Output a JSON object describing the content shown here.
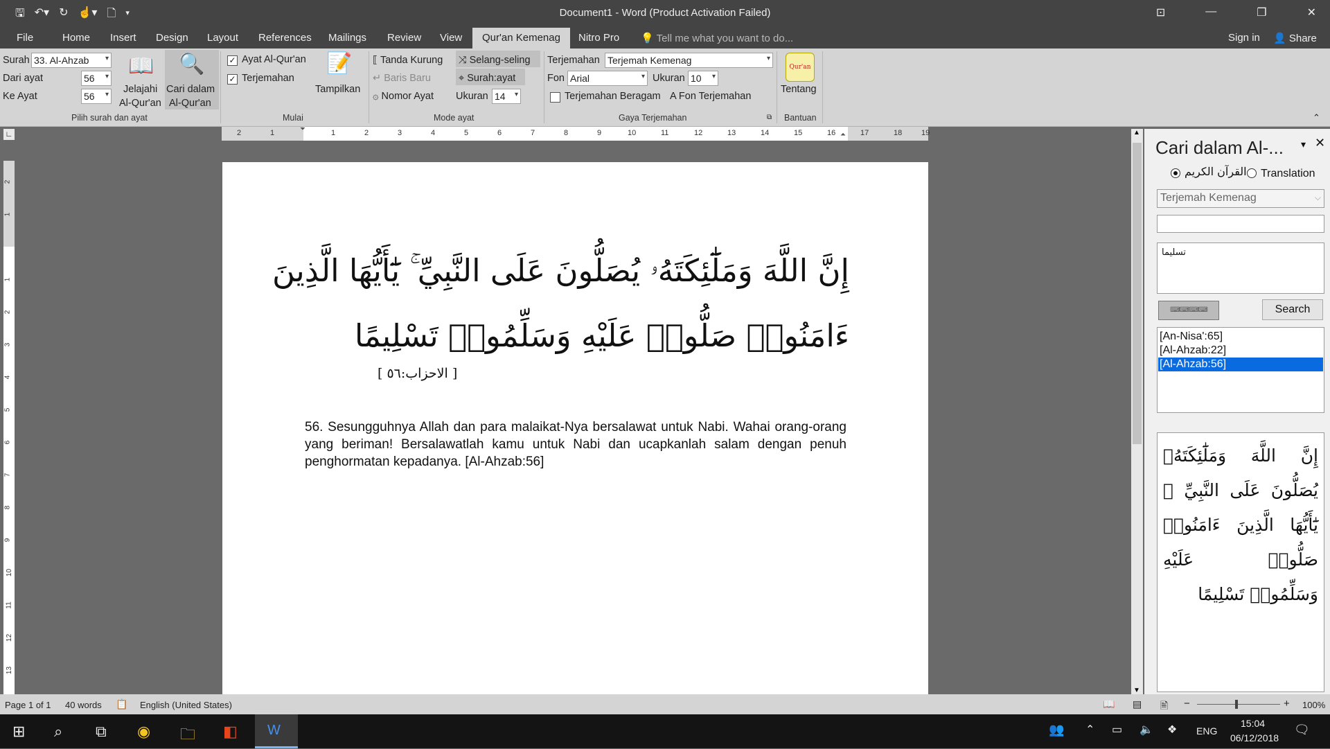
{
  "window": {
    "title": "Document1 - Word (Product Activation Failed)",
    "qat_icons": [
      "save-icon",
      "undo-icon",
      "redo-icon",
      "touch-mode-icon",
      "new-doc-icon",
      "customize-icon"
    ],
    "controls": [
      "ribbon-display-icon",
      "minimize-icon",
      "maximize-icon",
      "close-icon"
    ]
  },
  "tabs": [
    "File",
    "Home",
    "Insert",
    "Design",
    "Layout",
    "References",
    "Mailings",
    "Review",
    "View",
    "Qur'an Kemenag",
    "Nitro Pro"
  ],
  "active_tab": "Qur'an Kemenag",
  "tell_me": "Tell me what you want to do...",
  "sign_in": "Sign in",
  "share": "Share",
  "ribbon": {
    "surah_label": "Surah",
    "surah_value": "33. Al-Ahzab",
    "dari_label": "Dari ayat",
    "dari_value": "56",
    "ke_label": "Ke Ayat",
    "ke_value": "56",
    "jelajahi_1": "Jelajahi",
    "jelajahi_2": "Al-Qur'an",
    "cari_1": "Cari dalam",
    "cari_2": "Al-Qur'an",
    "group1": "Pilih surah dan ayat",
    "ayat_check": "Ayat Al-Qur'an",
    "terjemahan_check": "Terjemahan",
    "tampilkan": "Tampilkan",
    "group2": "Mulai",
    "tanda_kurung": "Tanda Kurung",
    "selang_seling": "Selang-seling",
    "baris_baru": "Baris Baru",
    "surah_ayat": "Surah:ayat",
    "nomor_ayat": "Nomor Ayat",
    "ukuran_label": "Ukuran",
    "ukuran_value": "14",
    "group3": "Mode ayat",
    "terjemahan_label": "Terjemahan",
    "terjemahan_value": "Terjemah Kemenag",
    "fon_label": "Fon",
    "fon_value": "Arial",
    "ukuran2_label": "Ukuran",
    "ukuran2_value": "10",
    "beragam": "Terjemahan Beragam",
    "fon_terjemahan": "Fon Terjemahan",
    "group4": "Gaya Terjemahan",
    "logo_text": "Qur'an",
    "tentang": "Tentang",
    "group5": "Bantuan"
  },
  "ruler_h": [
    "2",
    "1",
    "1",
    "1",
    "2",
    "3",
    "4",
    "5",
    "6",
    "7",
    "8",
    "9",
    "10",
    "11",
    "12",
    "13",
    "14",
    "15",
    "16",
    "17",
    "18",
    "19"
  ],
  "ruler_v": [
    "2",
    "1",
    "1",
    "2",
    "3",
    "4",
    "5",
    "6",
    "7",
    "8",
    "9",
    "10",
    "11",
    "12",
    "13"
  ],
  "document": {
    "arabic_line1": "إِنَّ اللَّهَ وَمَلَٰٓئِكَتَهُۥ يُصَلُّونَ عَلَى النَّبِيِّ ۚ يَٰٓأَيُّهَا الَّذِينَ",
    "arabic_line2": "ءَامَنُوا۟ صَلُّوا۟ عَلَيْهِ وَسَلِّمُوا۟ تَسْلِيمًا",
    "verse_ref": "[ الاحزاب:٥٦ ]",
    "translation": "56.  Sesungguhnya Allah dan para malaikat-Nya bersalawat untuk Nabi. Wahai orang-orang yang beriman! Bersalawatlah kamu untuk Nabi dan ucapkanlah salam dengan penuh penghormatan kepadanya. [Al-Ahzab:56]"
  },
  "pane": {
    "title": "Cari dalam Al-...",
    "radio_quran": "القرآن الكريم",
    "radio_translation": "Translation",
    "translation_select": "Terjemah Kemenag",
    "search_text": "تسليما",
    "search_button": "Search",
    "results": [
      "[An-Nisa':65]",
      "[Al-Ahzab:22]",
      "[Al-Ahzab:56]"
    ],
    "selected_result": 2,
    "preview": "إِنَّ اللَّهَ وَمَلَٰٓئِكَتَهُۥ يُصَلُّونَ عَلَى النَّبِيِّ ۚ يَٰٓأَيُّهَا الَّذِينَ ءَامَنُوا۟ صَلُّوا۟ عَلَيْهِ وَسَلِّمُوا۟ تَسْلِيمًا"
  },
  "status": {
    "page": "Page 1 of 1",
    "words": "40 words",
    "language": "English (United States)",
    "zoom": "100%"
  },
  "taskbar": {
    "lang": "ENG",
    "time": "15:04",
    "date": "06/12/2018"
  }
}
